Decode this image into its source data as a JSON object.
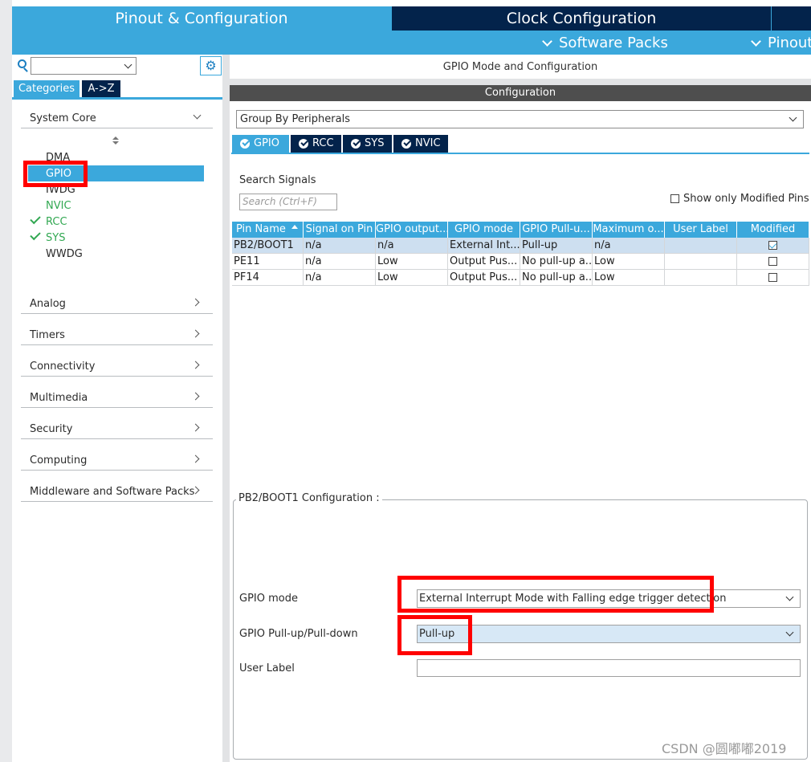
{
  "top": {
    "pinout_config": "Pinout & Configuration",
    "clock_config": "Clock Configuration",
    "software_packs": "Software Packs",
    "pinout": "Pinout"
  },
  "left": {
    "tabs": {
      "categories": "Categories",
      "az": "A->Z"
    },
    "sections": {
      "system_core": "System Core",
      "analog": "Analog",
      "timers": "Timers",
      "connectivity": "Connectivity",
      "multimedia": "Multimedia",
      "security": "Security",
      "computing": "Computing",
      "middleware": "Middleware and Software Packs"
    },
    "peripherals": [
      "DMA",
      "GPIO",
      "IWDG",
      "NVIC",
      "RCC",
      "SYS",
      "WWDG"
    ]
  },
  "right": {
    "title": "GPIO Mode and Configuration",
    "config_bar": "Configuration",
    "group_by": "Group By Peripherals",
    "tabs": [
      "GPIO",
      "RCC",
      "SYS",
      "NVIC"
    ],
    "search_label": "Search Signals",
    "search_placeholder": "Search (Ctrl+F)",
    "show_modified": "Show only Modified Pins",
    "table": {
      "headers": [
        "Pin Name",
        "Signal on Pin",
        "GPIO output...",
        "GPIO mode",
        "GPIO Pull-u...",
        "Maximum o...",
        "User Label",
        "Modified"
      ],
      "rows": [
        [
          "PB2/BOOT1",
          "n/a",
          "n/a",
          "External Int...",
          "Pull-up",
          "n/a",
          ""
        ],
        [
          "PE11",
          "n/a",
          "Low",
          "Output Pus...",
          "No pull-up a...",
          "Low",
          ""
        ],
        [
          "PF14",
          "n/a",
          "Low",
          "Output Pus...",
          "No pull-up a...",
          "Low",
          ""
        ]
      ],
      "modified": [
        true,
        false,
        false
      ]
    },
    "pin_config": {
      "title": "PB2/BOOT1 Configuration :",
      "gpio_mode_label": "GPIO mode",
      "gpio_mode_value": "External Interrupt Mode with Falling edge trigger detection",
      "pull_label": "GPIO Pull-up/Pull-down",
      "pull_value": "Pull-up",
      "user_label": "User Label",
      "user_label_value": ""
    }
  },
  "watermark": "CSDN @圆嘟嘟2019",
  "colors": {
    "accent": "#3ba8dc",
    "dark": "#03234b",
    "green": "#32a852",
    "highlight": "#ff0000"
  }
}
